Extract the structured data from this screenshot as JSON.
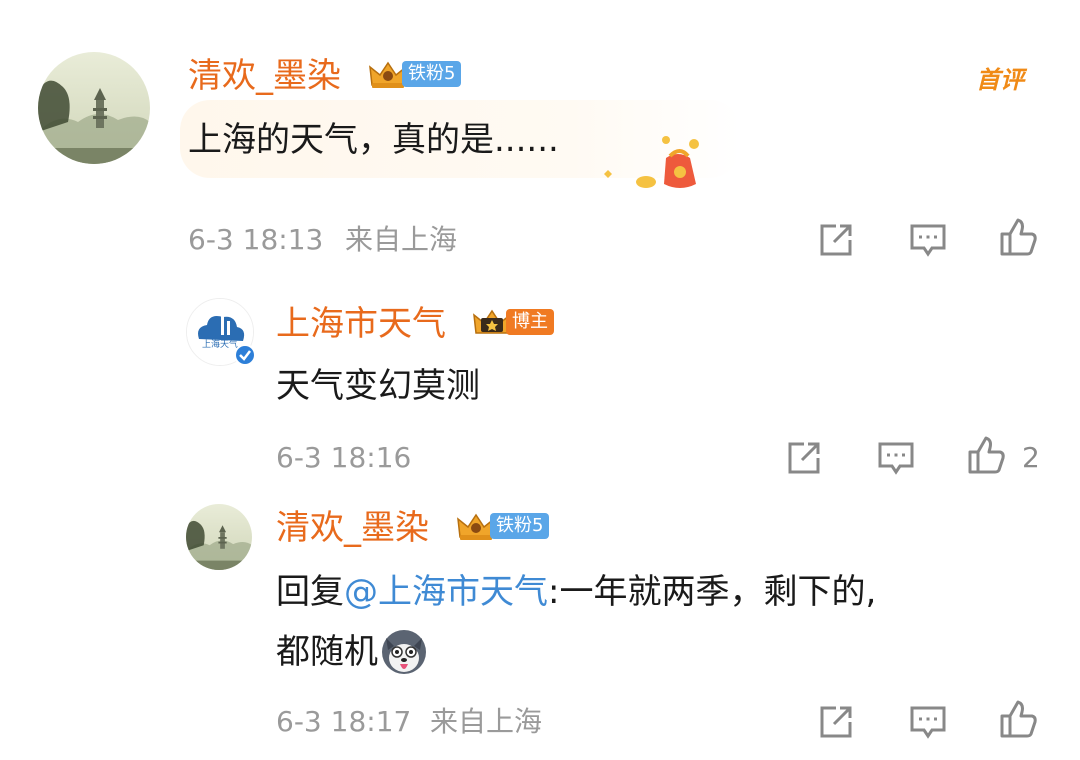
{
  "comments": [
    {
      "username": "清欢_墨染",
      "badge": "铁粉5",
      "text": "上海的天气，真的是......",
      "tag": "首评",
      "time": "6-3 18:13",
      "location": "来自上海",
      "likes": ""
    }
  ],
  "replies": [
    {
      "username": "上海市天气",
      "badge": "博主",
      "avatar_text": "上海天气",
      "text": "天气变幻莫测",
      "time": "6-3 18:16",
      "likes": "2"
    },
    {
      "username": "清欢_墨染",
      "badge": "铁粉5",
      "reply_prefix": "回复",
      "mention": "@上海市天气",
      "reply_text": ":一年就两季，剩下的,",
      "reply_text_2": "都随机",
      "time": "6-3 18:17",
      "location": "来自上海"
    }
  ],
  "colors": {
    "username": "#e86a1c",
    "mention": "#3f8ad4",
    "meta": "#9a9a9a",
    "fan_badge": "#5aa6e8",
    "host_badge": "#f07a22"
  },
  "icons": [
    "share-icon",
    "comment-icon",
    "like-icon",
    "lucky-bag-sticker",
    "husky-emoji",
    "verified-icon",
    "crown-icon"
  ]
}
